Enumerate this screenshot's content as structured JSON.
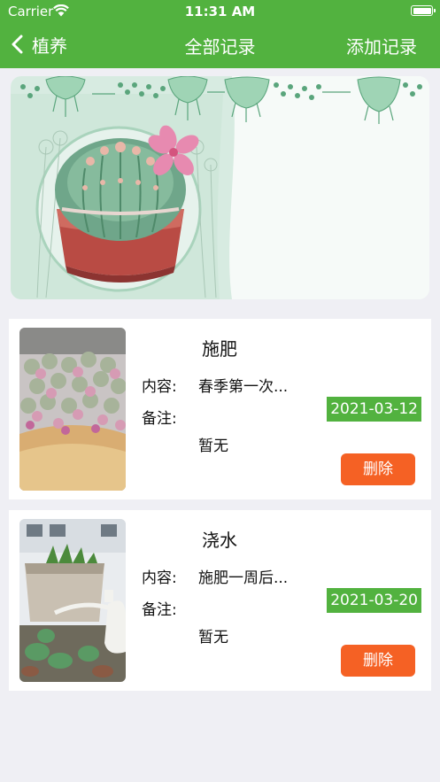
{
  "status_bar": {
    "carrier": "Carrier",
    "time": "11:31 AM"
  },
  "nav": {
    "back_label": "植养",
    "title": "全部记录",
    "right_action": "添加记录"
  },
  "records": [
    {
      "title": "施肥",
      "content_label": "内容:",
      "content": "春季第一次...",
      "note_label": "备注:",
      "note": "暂无",
      "date": "2021-03-12",
      "delete_label": "删除",
      "thumbnail": "succulent-pot-photo"
    },
    {
      "title": "浇水",
      "content_label": "内容:",
      "content": "施肥一周后...",
      "note_label": "备注:",
      "note": "暂无",
      "date": "2021-03-20",
      "delete_label": "删除",
      "thumbnail": "watering-succulent-photo"
    }
  ],
  "colors": {
    "nav_green": "#52b23f",
    "delete_orange": "#f56124",
    "background": "#efeff4"
  }
}
